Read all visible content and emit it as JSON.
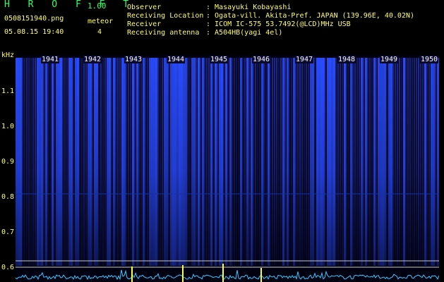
{
  "app": {
    "name": "H R O F F T",
    "version": "1.00"
  },
  "file": {
    "name": "0508151940.png",
    "datetime": "05.08.15 19:40"
  },
  "counter": {
    "label": "meteor",
    "value": "4"
  },
  "station": {
    "observer_key": "Observer",
    "observer": ": Masayuki Kobayashi",
    "location_key": "Receiving Location",
    "location": ": Ogata-vill. Akita-Pref. JAPAN (139.96E, 40.02N)",
    "receiver_key": "Receiver",
    "receiver": ": ICOM IC-575 53.7492(@LCD)MHz USB",
    "antenna_key": "Receiving antenna",
    "antenna": ": A504HB(yagi 4el)"
  },
  "axis": {
    "unit": "kHz",
    "freq_labels": [
      "1.1",
      "1.0",
      "0.9",
      "0.8",
      "0.7",
      "0.6"
    ],
    "time_labels": [
      "1941",
      "1942",
      "1943",
      "1944",
      "1945",
      "1946",
      "1947",
      "1948",
      "1949",
      "1950"
    ]
  },
  "colors": {
    "background": "#000000",
    "signal": "#1e3cff",
    "echo": "#ffff33",
    "trace": "#33ccff",
    "text": "#ffff66"
  }
}
